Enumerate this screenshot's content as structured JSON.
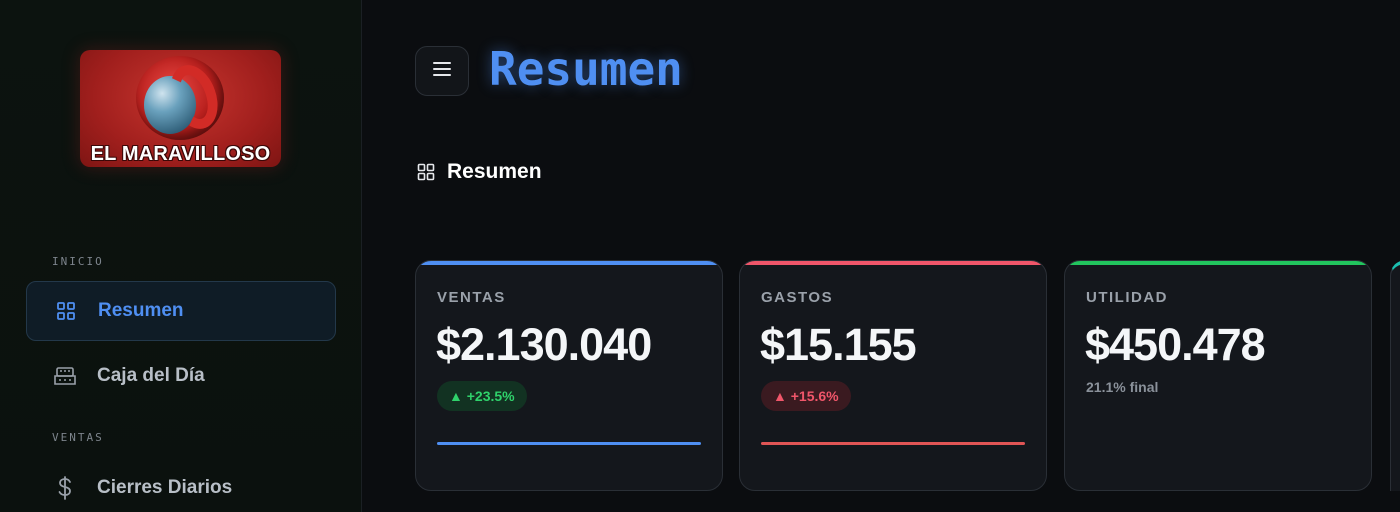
{
  "brand": {
    "logo_text": "EL MARAVILLOSO"
  },
  "sidebar": {
    "sections": [
      {
        "label": "INICIO"
      },
      {
        "label": "VENTAS"
      }
    ],
    "items": [
      {
        "label": "Resumen",
        "icon": "grid-icon",
        "active": true
      },
      {
        "label": "Caja del Día",
        "icon": "cash-register-icon",
        "active": false
      },
      {
        "label": "Cierres Diarios",
        "icon": "dollar-icon",
        "active": false
      }
    ]
  },
  "header": {
    "title": "Resumen",
    "menu_icon": "hamburger-menu-icon"
  },
  "section": {
    "title": "Resumen",
    "icon": "grid-icon"
  },
  "cards": [
    {
      "label": "VENTAS",
      "value": "$2.130.040",
      "badge": "▲ +23.5%",
      "accent": "#4f8ff2"
    },
    {
      "label": "GASTOS",
      "value": "$15.155",
      "badge": "▲ +15.6%",
      "accent": "#f0566a"
    },
    {
      "label": "UTILIDAD",
      "value": "$450.478",
      "note": "21.1% final",
      "accent": "#22c55e"
    }
  ],
  "colors": {
    "accent": "#4f8ff2",
    "positive": "#2fd16b",
    "negative": "#f0566a",
    "teal": "#1bbfb0",
    "background": "#0b0d10"
  }
}
